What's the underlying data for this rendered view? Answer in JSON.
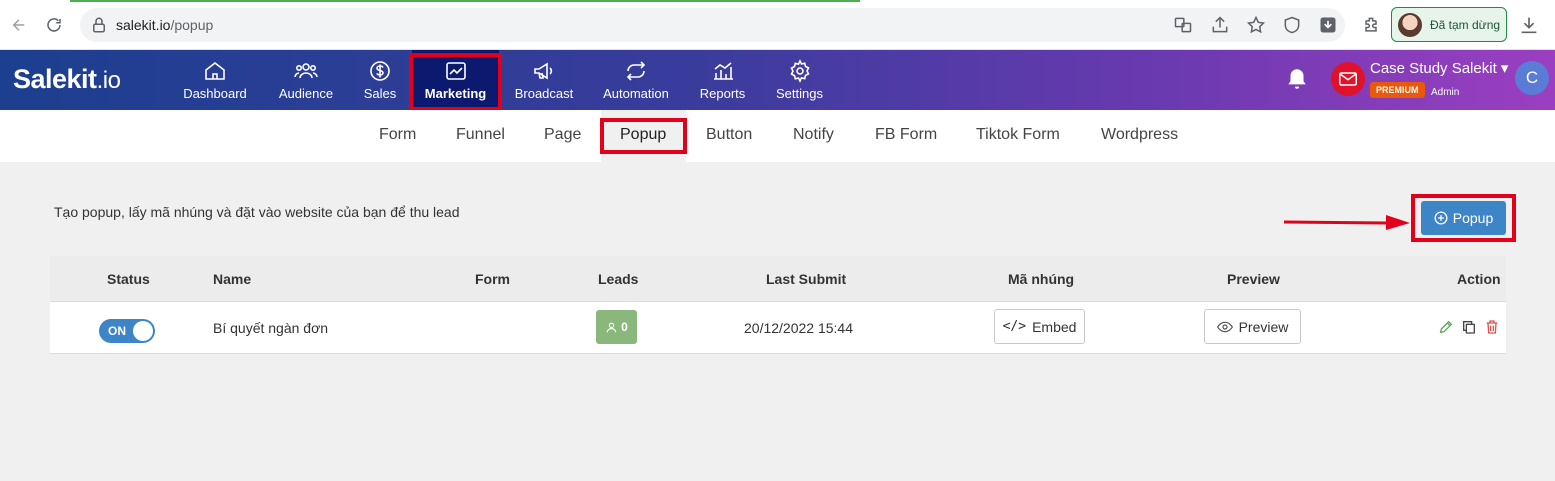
{
  "browser": {
    "url_host": "salekit.io",
    "url_path": "/popup",
    "profile_status": "Đã tạm dừng"
  },
  "app": {
    "logo_main": "Salekit",
    "logo_suffix": ".io",
    "nav": [
      {
        "label": "Dashboard",
        "icon": "home-icon"
      },
      {
        "label": "Audience",
        "icon": "users-icon"
      },
      {
        "label": "Sales",
        "icon": "dollar-icon"
      },
      {
        "label": "Marketing",
        "icon": "chart-icon",
        "active": true
      },
      {
        "label": "Broadcast",
        "icon": "megaphone-icon"
      },
      {
        "label": "Automation",
        "icon": "repeat-icon"
      },
      {
        "label": "Reports",
        "icon": "bar-chart-icon"
      },
      {
        "label": "Settings",
        "icon": "gear-icon"
      }
    ],
    "account_name": "Case Study Salekit",
    "account_plan": "PREMIUM",
    "account_role": "Admin",
    "avatar_initial": "C"
  },
  "sub_nav": [
    "Form",
    "Funnel",
    "Page",
    "Popup",
    "Button",
    "Notify",
    "FB Form",
    "Tiktok Form",
    "Wordpress"
  ],
  "content": {
    "intro": "Tạo popup, lấy mã nhúng và đặt vào website của bạn để thu lead",
    "add_button_label": "Popup"
  },
  "table": {
    "headers": {
      "status": "Status",
      "name": "Name",
      "form": "Form",
      "leads": "Leads",
      "last_submit": "Last Submit",
      "embed": "Mã nhúng",
      "preview": "Preview",
      "action": "Action"
    },
    "rows": [
      {
        "status": "ON",
        "name": "Bí quyết ngàn đơn",
        "form": "",
        "leads": "0",
        "last_submit": "20/12/2022 15:44",
        "embed_label": "Embed",
        "preview_label": "Preview"
      }
    ]
  },
  "colors": {
    "primary": "#3d85c6",
    "highlight": "#e3001b",
    "leads_green": "#8ab77b"
  }
}
